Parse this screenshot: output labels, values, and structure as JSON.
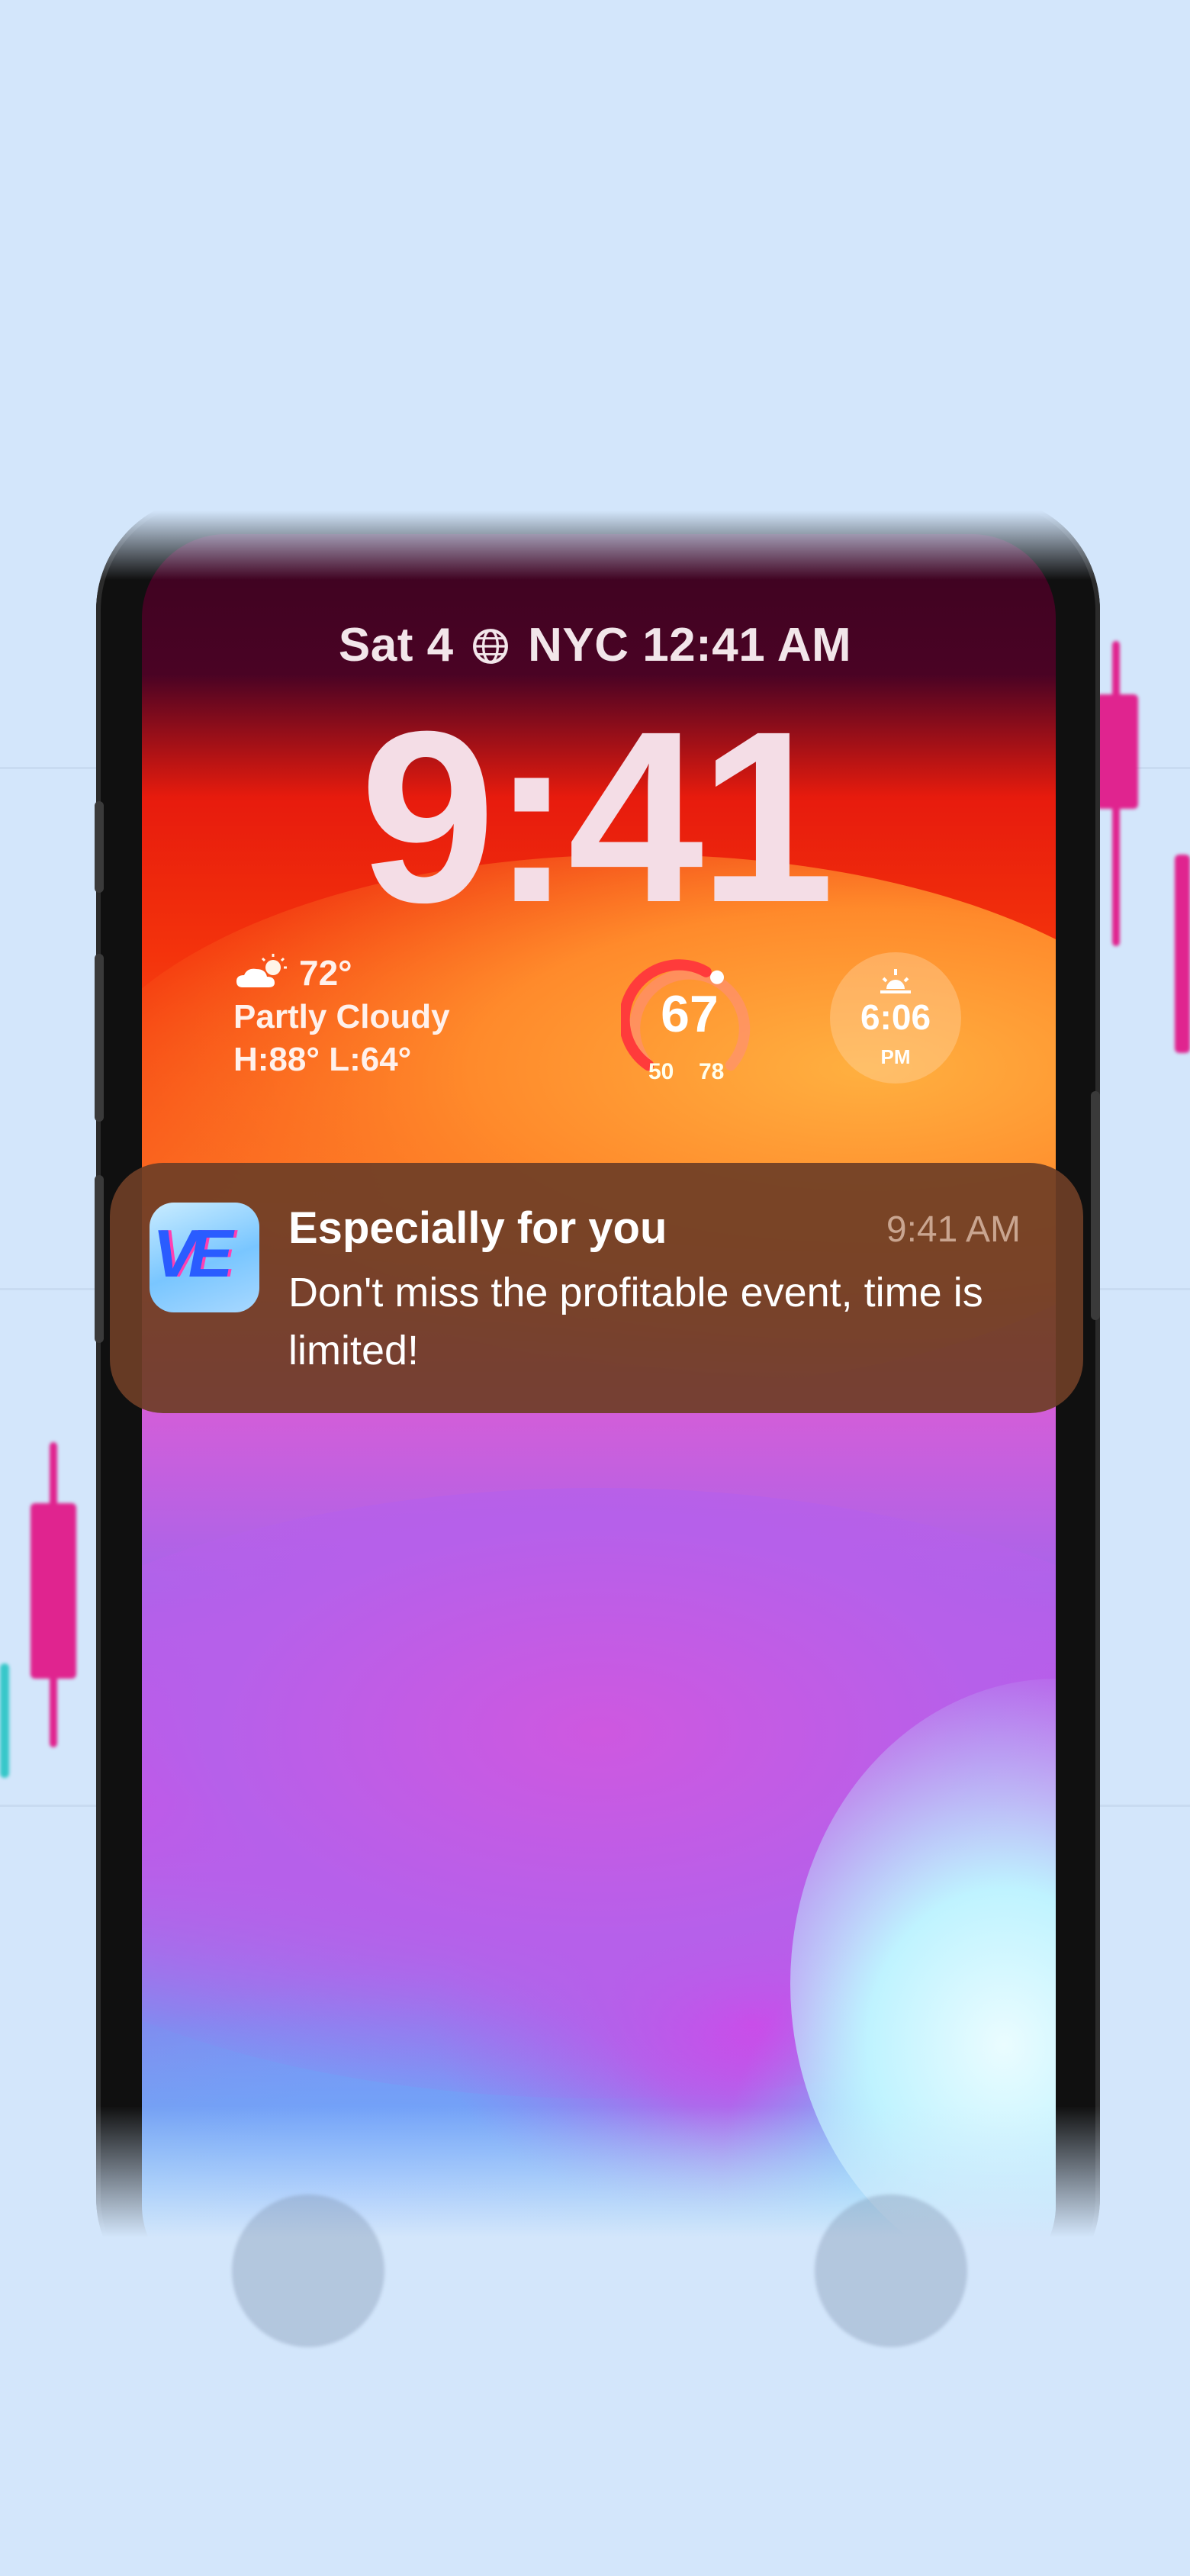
{
  "lockscreen": {
    "date_location_time": "Sat 4  NYC 12:41 AM",
    "date": "Sat 4",
    "city_time": "NYC 12:41 AM",
    "clock": "9:41"
  },
  "weather_widget": {
    "icon": "partly-cloudy-icon",
    "temperature": "72°",
    "condition": "Partly Cloudy",
    "high_low": "H:88° L:64°"
  },
  "gauge_widget": {
    "value": "67",
    "low": "50",
    "high": "78"
  },
  "sunset_widget": {
    "icon": "sunset-icon",
    "time": "6:06",
    "ampm": "PM"
  },
  "notification": {
    "app_icon": "app-logo-icon",
    "title": "Especially for you",
    "time": "9:41 AM",
    "body": "Don't miss the profitable event, time is limited!"
  },
  "colors": {
    "background": "#d3e6fb",
    "notification_bg": "#6e3e26",
    "candle": "#e0248f"
  }
}
